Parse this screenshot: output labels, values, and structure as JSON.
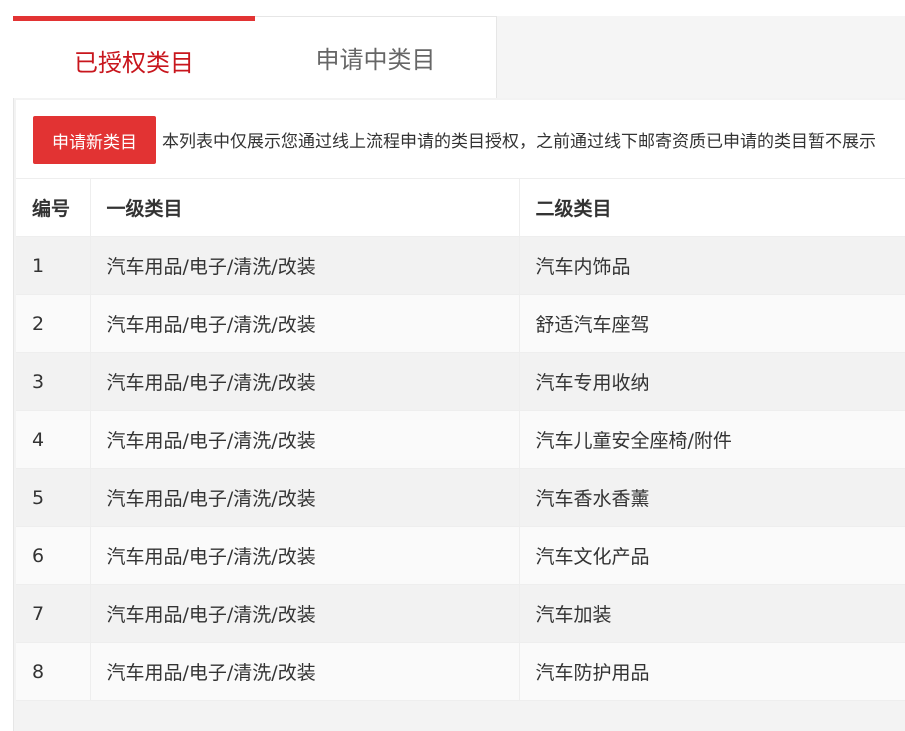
{
  "tabs": [
    {
      "label": "已授权类目",
      "active": true
    },
    {
      "label": "申请中类目",
      "active": false
    }
  ],
  "toolbar": {
    "apply_button": "申请新类目",
    "notice": "本列表中仅展示您通过线上流程申请的类目授权，之前通过线下邮寄资质已申请的类目暂不展示"
  },
  "table": {
    "headers": [
      "编号",
      "一级类目",
      "二级类目"
    ],
    "rows": [
      [
        "1",
        "汽车用品/电子/清洗/改装",
        "汽车内饰品"
      ],
      [
        "2",
        "汽车用品/电子/清洗/改装",
        "舒适汽车座驾"
      ],
      [
        "3",
        "汽车用品/电子/清洗/改装",
        "汽车专用收纳"
      ],
      [
        "4",
        "汽车用品/电子/清洗/改装",
        "汽车儿童安全座椅/附件"
      ],
      [
        "5",
        "汽车用品/电子/清洗/改装",
        "汽车香水香薰"
      ],
      [
        "6",
        "汽车用品/电子/清洗/改装",
        "汽车文化产品"
      ],
      [
        "7",
        "汽车用品/电子/清洗/改装",
        "汽车加装"
      ],
      [
        "8",
        "汽车用品/电子/清洗/改装",
        "汽车防护用品"
      ]
    ]
  },
  "colors": {
    "accent": "#e23333",
    "active_tab_text": "#c8161d"
  }
}
